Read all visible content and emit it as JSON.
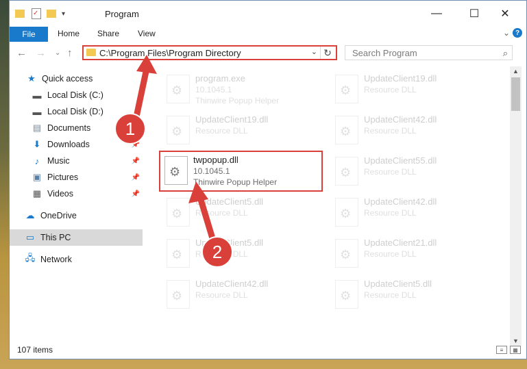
{
  "window": {
    "title": "Program",
    "controls": {
      "minimize": "—",
      "maximize": "☐",
      "close": "✕"
    }
  },
  "ribbon": {
    "tabs": [
      "File",
      "Home",
      "Share",
      "View"
    ],
    "expand_icon": "chevron-down-icon",
    "help": "?"
  },
  "address_bar": {
    "path": "C:\\Program Files\\Program Directory",
    "search_placeholder": "Search Program"
  },
  "sidebar": {
    "items": [
      {
        "label": "Quick access",
        "icon": "star-icon",
        "pinned": false
      },
      {
        "label": "Local Disk (C:)",
        "icon": "drive-icon",
        "pinned": false
      },
      {
        "label": "Local Disk (D:)",
        "icon": "drive-icon",
        "pinned": false
      },
      {
        "label": "Documents",
        "icon": "documents-icon",
        "pinned": false
      },
      {
        "label": "Downloads",
        "icon": "download-icon",
        "pinned": true
      },
      {
        "label": "Music",
        "icon": "music-icon",
        "pinned": true
      },
      {
        "label": "Pictures",
        "icon": "pictures-icon",
        "pinned": true
      },
      {
        "label": "Videos",
        "icon": "videos-icon",
        "pinned": true
      },
      {
        "label": "OneDrive",
        "icon": "cloud-icon",
        "pinned": false
      },
      {
        "label": "This PC",
        "icon": "computer-icon",
        "pinned": false,
        "selected": true
      },
      {
        "label": "Network",
        "icon": "network-icon",
        "pinned": false
      }
    ]
  },
  "files": {
    "left": [
      {
        "name": "program.exe",
        "version": "10.1045.1",
        "desc": "Thinwire Popup Helper"
      },
      {
        "name": "UpdateClient19.dll",
        "version": "Resource DLL",
        "desc": ""
      },
      {
        "name": "twpopup.dll",
        "version": "10.1045.1",
        "desc": "Thinwire Popup Helper",
        "highlighted": true
      },
      {
        "name": "UpdateClient5.dll",
        "version": "Resource DLL",
        "desc": ""
      },
      {
        "name": "UpdateClient5.dll",
        "version": "Resource DLL",
        "desc": ""
      },
      {
        "name": "UpdateClient42.dll",
        "version": "Resource DLL",
        "desc": ""
      }
    ],
    "right": [
      {
        "name": "UpdateClient19.dll",
        "version": "Resource DLL"
      },
      {
        "name": "UpdateClient42.dll",
        "version": "Resource DLL"
      },
      {
        "name": "UpdateClient55.dll",
        "version": "Resource DLL"
      },
      {
        "name": "UpdateClient42.dll",
        "version": "Resource DLL"
      },
      {
        "name": "UpdateClient21.dll",
        "version": "Resource DLL"
      },
      {
        "name": "UpdateClient5.dll",
        "version": "Resource DLL"
      }
    ]
  },
  "status": {
    "count": "107 items"
  },
  "annotations": {
    "step1": "1",
    "step2": "2"
  },
  "colors": {
    "accent": "#1979ca",
    "highlight": "#d9403a"
  }
}
